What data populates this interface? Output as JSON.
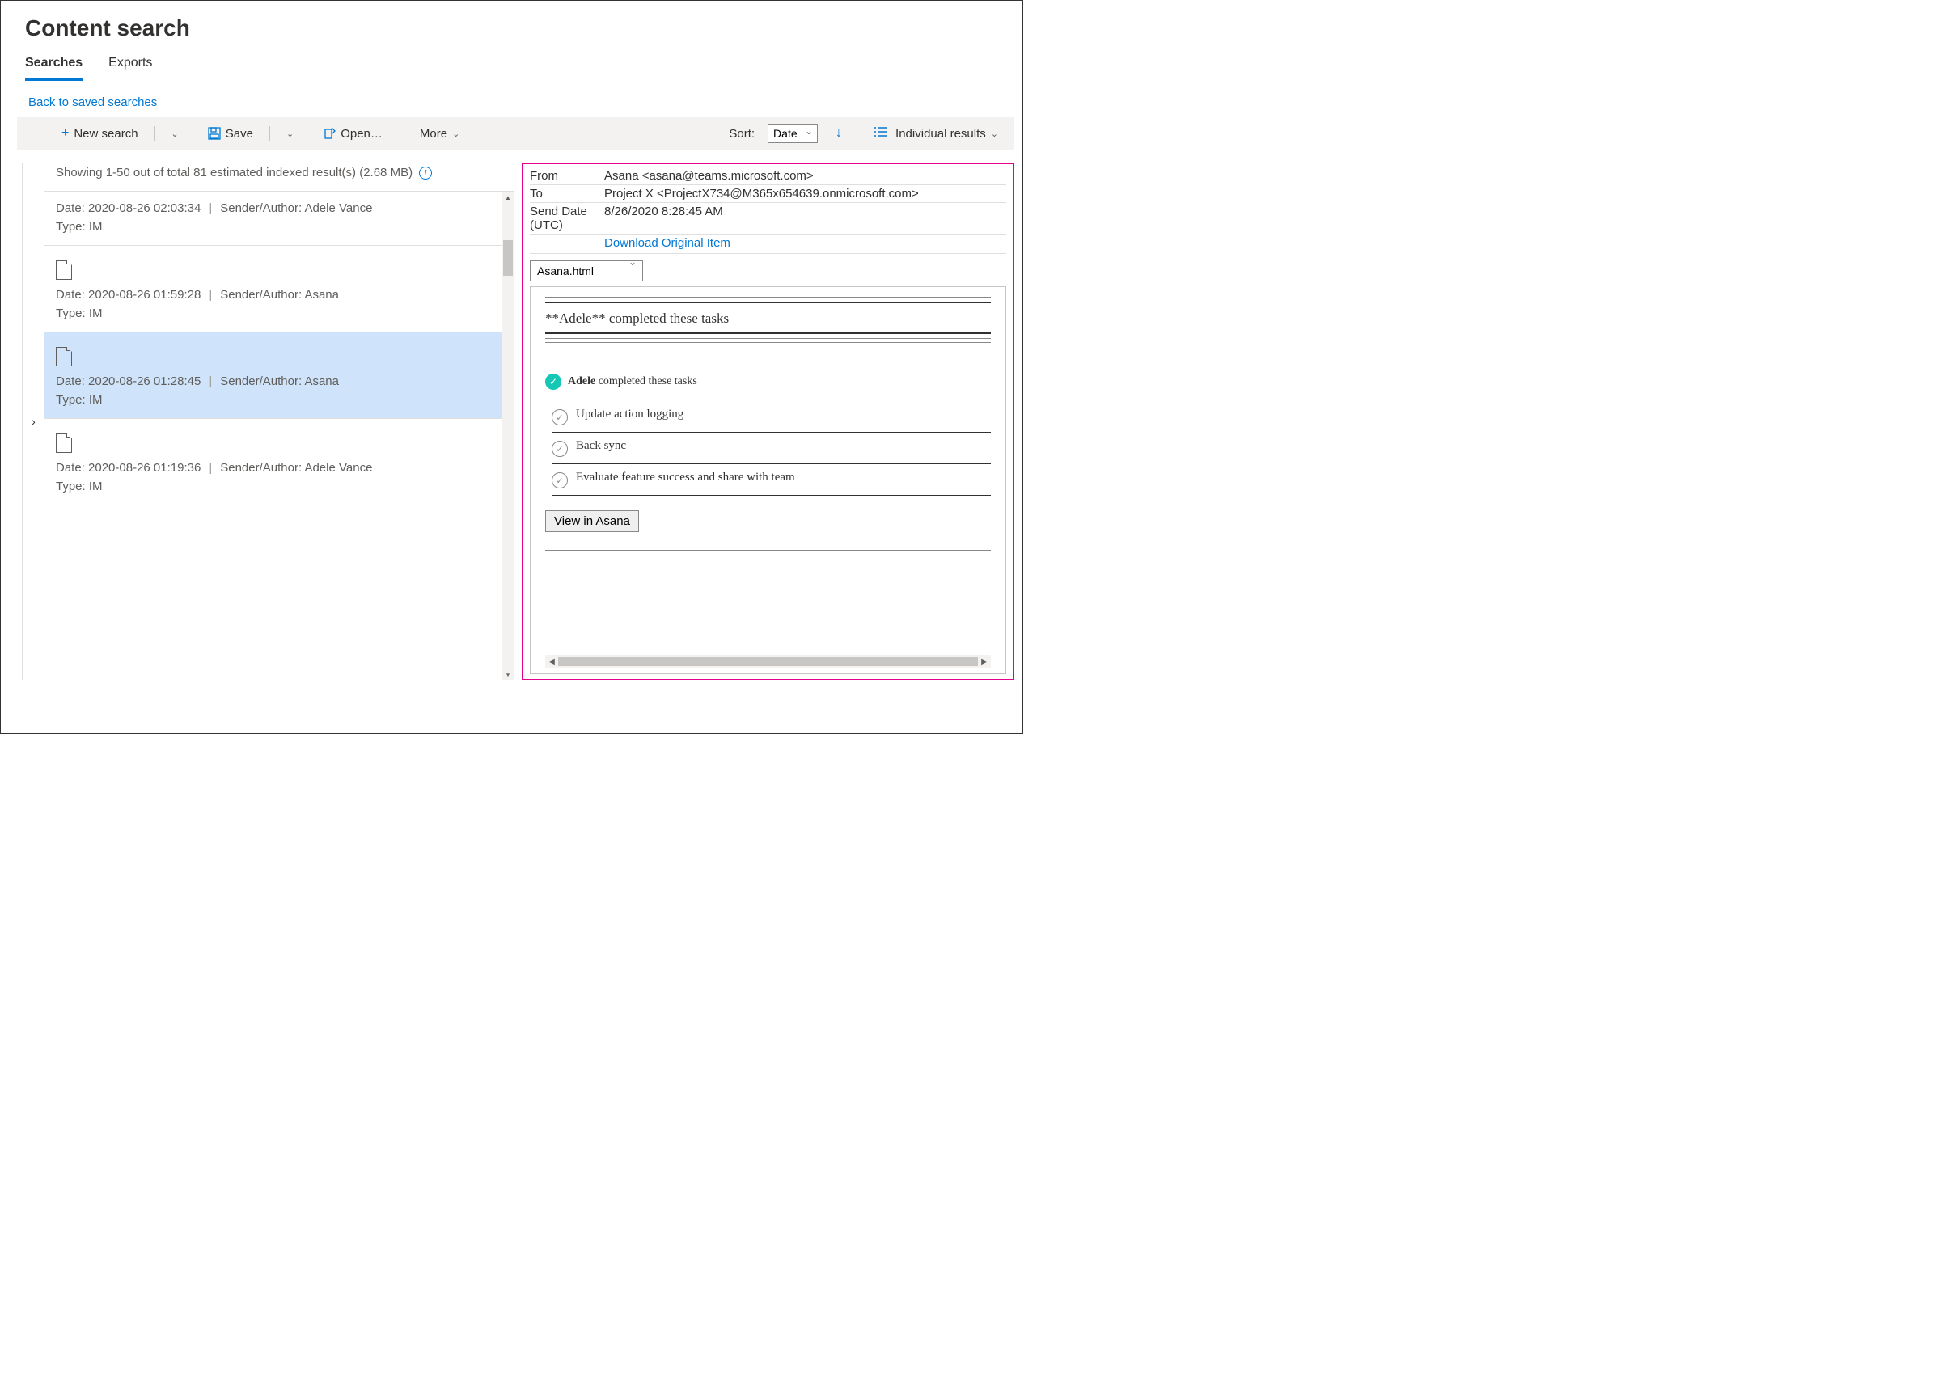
{
  "header": {
    "title": "Content search",
    "tabs": [
      "Searches",
      "Exports"
    ],
    "active_tab": 0,
    "back_link": "Back to saved searches"
  },
  "toolbar": {
    "new_search": "New search",
    "save": "Save",
    "open": "Open…",
    "more": "More",
    "sort_label": "Sort:",
    "sort_value": "Date",
    "view_mode": "Individual results"
  },
  "status": {
    "text": "Showing 1-50 out of total 81 estimated indexed result(s) (2.68 MB)"
  },
  "results": [
    {
      "has_icon": false,
      "date": "2020-08-26 02:03:34",
      "sender": "Adele Vance",
      "type": "IM",
      "selected": false
    },
    {
      "has_icon": true,
      "date": "2020-08-26 01:59:28",
      "sender": "Asana",
      "type": "IM",
      "selected": false
    },
    {
      "has_icon": true,
      "date": "2020-08-26 01:28:45",
      "sender": "Asana",
      "type": "IM",
      "selected": true
    },
    {
      "has_icon": true,
      "date": "2020-08-26 01:19:36",
      "sender": "Adele Vance",
      "type": "IM",
      "selected": false
    }
  ],
  "result_labels": {
    "date_prefix": "Date: ",
    "sender_prefix": "Sender/Author: ",
    "type_prefix": "Type: "
  },
  "detail": {
    "meta": {
      "from_label": "From",
      "from_value": "Asana <asana@teams.microsoft.com>",
      "to_label": "To",
      "to_value": "Project X <ProjectX734@M365x654639.onmicrosoft.com>",
      "date_label": "Send Date (UTC)",
      "date_value": "8/26/2020 8:28:45 AM"
    },
    "download_link": "Download Original Item",
    "attachment": "Asana.html",
    "preview": {
      "heading_raw": "**Adele** completed these tasks",
      "card_actor": "Adele",
      "card_verb": " completed these tasks",
      "tasks": [
        "Update action logging",
        "Back sync",
        "Evaluate feature success and share with team"
      ],
      "view_button": "View in Asana"
    }
  }
}
